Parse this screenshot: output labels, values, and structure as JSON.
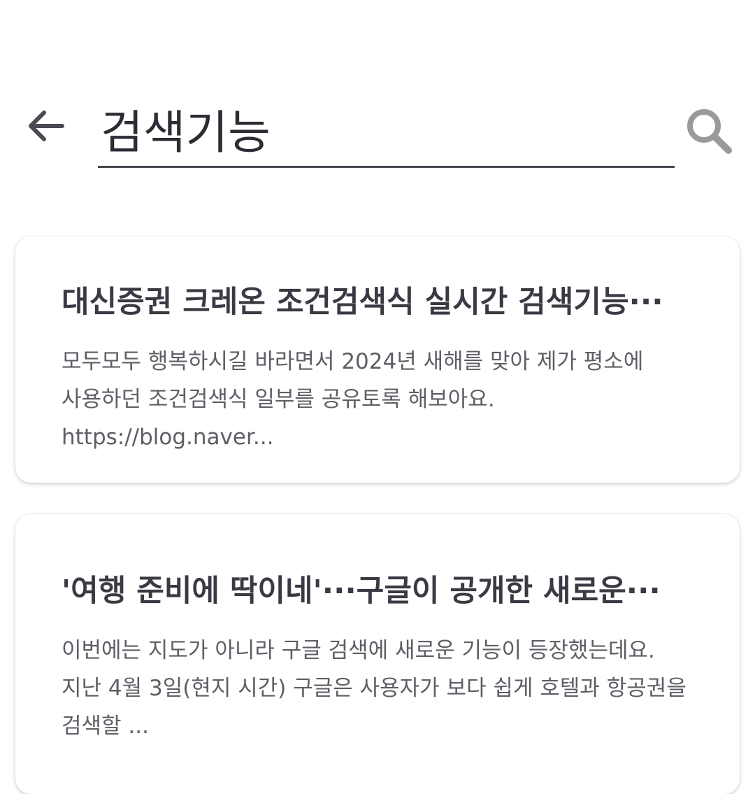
{
  "search": {
    "query": "검색기능",
    "back_icon": "arrow-left-icon",
    "search_icon": "magnifier-icon",
    "icon_color": "#4a4a52",
    "search_icon_color": "#9a9a9a"
  },
  "results": [
    {
      "title": "대신증권 크레온 조건검색식 실시간 검색기능···",
      "snippet": "모두모두 행복하시길 바라면서 2024년 새해를 맞아 제가 평소에 사용하던 조건검색식 일부를 공유토록 해보아요. https://blog.naver..."
    },
    {
      "title": "'여행 준비에 딱이네'···구글이 공개한 새로운···",
      "snippet": "이번에는 지도가 아니라 구글 검색에 새로운 기능이 등장했는데요. 지난 4월 3일(현지 시간) 구글은 사용자가 보다 쉽게 호텔과 항공권을 검색할 ..."
    }
  ]
}
